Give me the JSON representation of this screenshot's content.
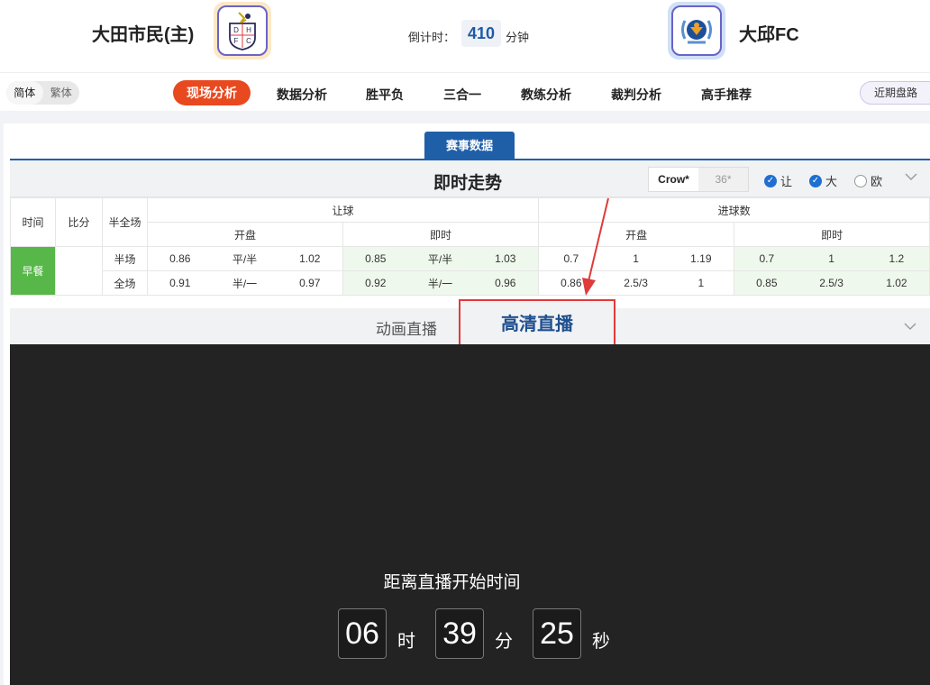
{
  "header": {
    "home_team": "大田市民(主)",
    "away_team": "大邱FC",
    "home_logo_text": [
      "D",
      "H",
      "F",
      "C"
    ],
    "countdown_label": "倒计时：",
    "countdown_value": "410",
    "countdown_unit": "分钟"
  },
  "nav": {
    "lang_simplified": "简体",
    "lang_traditional": "繁体",
    "items": [
      "现场分析",
      "数据分析",
      "胜平负",
      "三合一",
      "教练分析",
      "裁判分析",
      "高手推荐"
    ],
    "active_index": 0,
    "recent": "近期盘路"
  },
  "panel": {
    "tab": "赛事数据",
    "trend_title": "即时走势",
    "company_active": "Crow*",
    "company_inactive": "36*",
    "opt_rang": "让",
    "opt_da": "大",
    "opt_ou": "欧"
  },
  "table": {
    "h_time": "时间",
    "h_score": "比分",
    "h_half": "半全场",
    "h_handicap": "让球",
    "h_goals": "进球数",
    "h_open": "开盘",
    "h_live": "即时",
    "early": "早餐",
    "rows": [
      {
        "label": "半场",
        "cells": [
          "0.86",
          "平/半",
          "1.02",
          "0.85",
          "平/半",
          "1.03",
          "0.7",
          "1",
          "1.19",
          "0.7",
          "1",
          "1.2"
        ]
      },
      {
        "label": "全场",
        "cells": [
          "0.91",
          "半/一",
          "0.97",
          "0.92",
          "半/一",
          "0.96",
          "0.86",
          "2.5/3",
          "1",
          "0.85",
          "2.5/3",
          "1.02"
        ]
      }
    ]
  },
  "live": {
    "anim_tab": "动画直播",
    "hd_tab": "高清直播",
    "start_label": "距离直播开始时间",
    "hours": "06",
    "hours_unit": "时",
    "minutes": "39",
    "minutes_unit": "分",
    "seconds": "25",
    "seconds_unit": "秒"
  },
  "colors": {
    "accent_orange": "#e8491f",
    "brand_blue": "#1f5fa8",
    "early_green": "#57b749",
    "highlight_red": "#e03a3a"
  }
}
